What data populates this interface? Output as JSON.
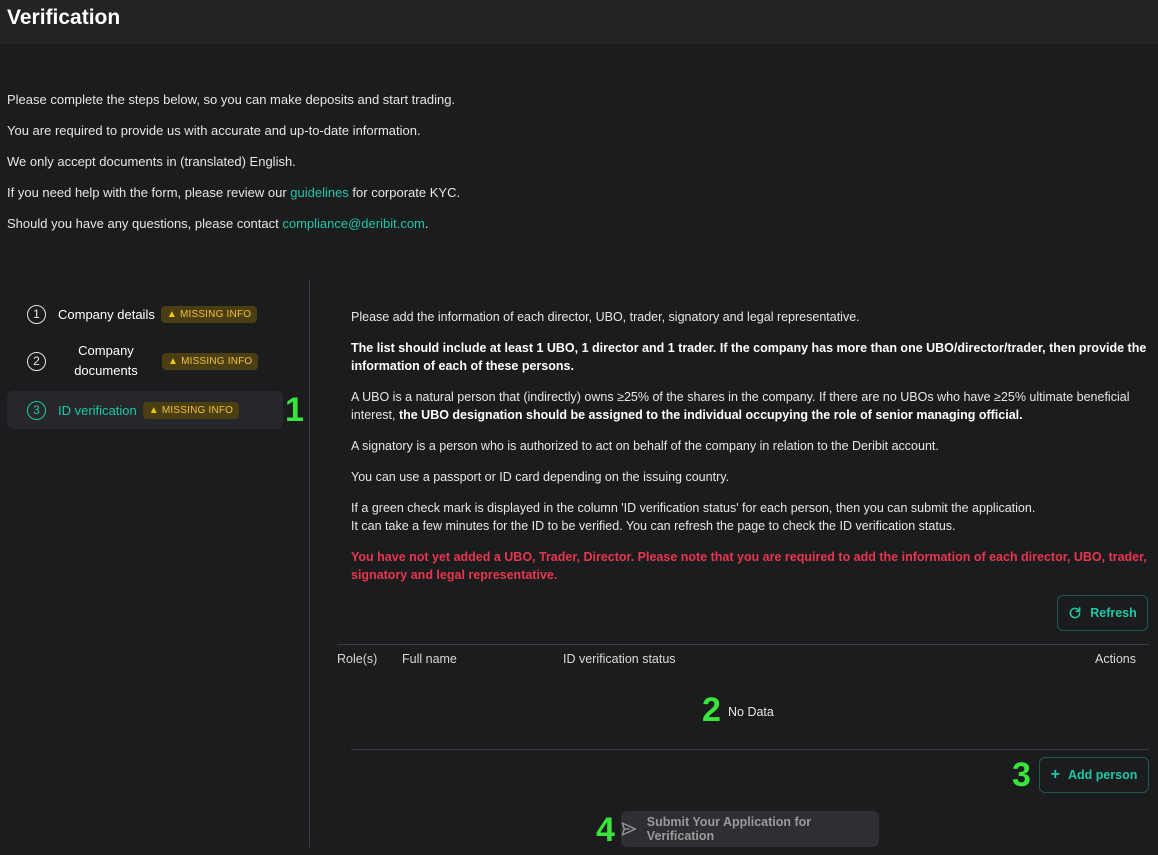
{
  "header": {
    "title": "Verification"
  },
  "intro": {
    "line1": "Please complete the steps below, so you can make deposits and start trading.",
    "line2": "You are required to provide us with accurate and up-to-date information.",
    "line3": "We only accept documents in (translated) English.",
    "line4_pre": "If you need help with the form, please review our ",
    "line4_link": "guidelines",
    "line4_post": " for corporate KYC.",
    "line5_pre": "Should you have any questions, please contact ",
    "line5_link": "compliance@deribit.com",
    "line5_post": "."
  },
  "steps": [
    {
      "num": "1",
      "label": "Company details",
      "badge": "MISSING INFO"
    },
    {
      "num": "2",
      "label": "Company documents",
      "badge": "MISSING INFO"
    },
    {
      "num": "3",
      "label": "ID verification",
      "badge": "MISSING INFO",
      "active": true
    }
  ],
  "annotations": {
    "a1": "1",
    "a2": "2",
    "a3": "3",
    "a4": "4"
  },
  "content": {
    "p1": "Please add the information of each director, UBO, trader, signatory and legal representative.",
    "p2": "The list should include at least 1 UBO, 1 director and 1 trader. If the company has more than one UBO/director/trader, then provide the information of each of these persons.",
    "p3_pre": "A UBO is a natural person that (indirectly) owns ≥25% of the shares in the company. If there are no UBOs who have ≥25% ultimate beneficial interest, ",
    "p3_bold": "the UBO designation should be assigned to the individual occupying the role of senior managing official.",
    "p4": "A signatory is a person who is authorized to act on behalf of the company in relation to the Deribit account.",
    "p5": "You can use a passport or ID card depending on the issuing country.",
    "p6a": "If a green check mark is displayed in the column 'ID verification status' for each person, then you can submit the application.",
    "p6b": "It can take a few minutes for the ID to be verified. You can refresh the page to check the ID verification status.",
    "warning": "You have not yet added a UBO, Trader, Director. Please note that you are required to add the information of each director, UBO, trader, signatory and legal representative."
  },
  "buttons": {
    "refresh": "Refresh",
    "add_person": "Add person",
    "submit": "Submit Your Application for Verification"
  },
  "table": {
    "columns": [
      "Role(s)",
      "Full name",
      "ID verification status",
      "Actions"
    ],
    "empty": "No Data"
  },
  "colors": {
    "accent": "#1fc7a7",
    "warning_text": "#e8364f",
    "badge_text": "#f0c040",
    "annotation": "#39e53a"
  },
  "icons": {
    "refresh": "refresh-icon",
    "add": "plus-icon",
    "submit": "send-icon",
    "badge": "warning-icon"
  }
}
